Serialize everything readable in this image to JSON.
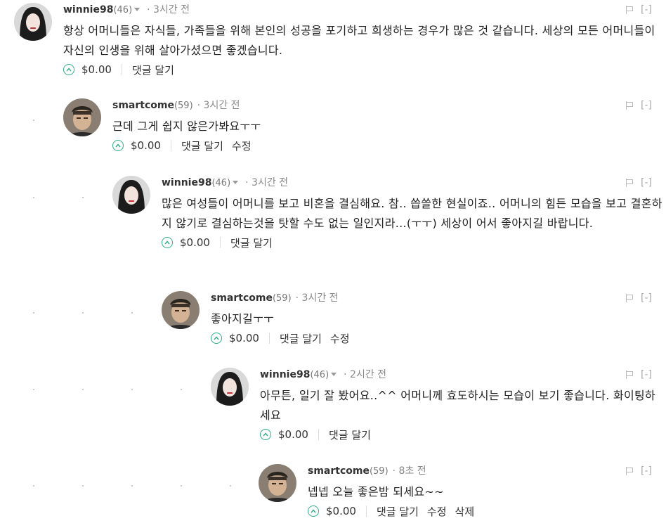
{
  "ui": {
    "report_label": "[-]",
    "upvote_value": "$0.00",
    "reply_label": "댓글 달기",
    "edit_label": "수정",
    "delete_label": "삭제"
  },
  "comments": [
    {
      "user": "winnie98",
      "rep": "(46)",
      "time": "· 3시간 전",
      "text": "항상 어머니들은 자식들, 가족들을 위해 본인의 성공을 포기하고 희생하는 경우가 많은 것 같습니다. 세상의 모든 어머니들이 자신의 인생을 위해 살아가셨으면 좋겠습니다."
    },
    {
      "user": "smartcome",
      "rep": "(59)",
      "time": "· 3시간 전",
      "text": "근데 그게 쉽지 않은가봐요ㅜㅜ"
    },
    {
      "user": "winnie98",
      "rep": "(46)",
      "time": "· 3시간 전",
      "text": "많은 여성들이 어머니를 보고 비혼을 결심해요. 참.. 씁쓸한 현실이죠.. 어머니의 힘든 모습을 보고 결혼하지 않기로 결심하는것을 탓할 수도 없는 일인지라...(ㅜㅜ) 세상이 어서 좋아지길 바랍니다."
    },
    {
      "user": "smartcome",
      "rep": "(59)",
      "time": "· 3시간 전",
      "text": "좋아지길ㅜㅜ"
    },
    {
      "user": "winnie98",
      "rep": "(46)",
      "time": "· 2시간 전",
      "text": "아무튼, 일기 잘 봤어요..^^ 어머니께 효도하시는 모습이 보기 좋습니다. 화이팅하세요"
    },
    {
      "user": "smartcome",
      "rep": "(59)",
      "time": "· 8초 전",
      "text": "넵넵 오늘 좋은밤 되세요~~"
    }
  ]
}
